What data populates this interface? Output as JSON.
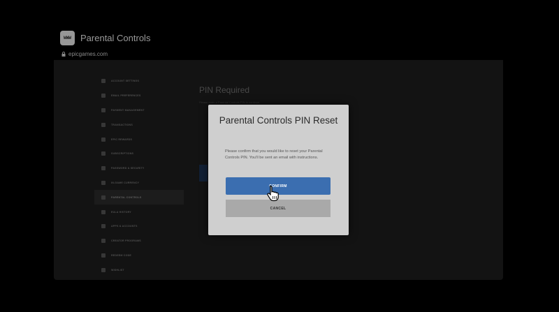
{
  "window": {
    "icon_text": "WWW",
    "title": "Parental Controls",
    "url": "epicgames.com"
  },
  "sidebar": {
    "items": [
      {
        "label": "ACCOUNT SETTINGS",
        "icon": "person-icon"
      },
      {
        "label": "EMAIL PREFERENCES",
        "icon": "bell-icon"
      },
      {
        "label": "PAYMENT MANAGEMENT",
        "icon": "card-icon"
      },
      {
        "label": "TRANSACTIONS",
        "icon": "receipt-icon"
      },
      {
        "label": "EPIC REWARDS",
        "icon": "reward-icon"
      },
      {
        "label": "SUBSCRIPTIONS",
        "icon": "subscription-icon"
      },
      {
        "label": "PASSWORD & SECURITY",
        "icon": "lock-icon"
      },
      {
        "label": "IN-GAME CURRENCY",
        "icon": "currency-icon"
      },
      {
        "label": "PARENTAL CONTROLS",
        "icon": "shield-icon",
        "active": true
      },
      {
        "label": "EULA HISTORY",
        "icon": "document-icon"
      },
      {
        "label": "APPS & ACCOUNTS",
        "icon": "apps-icon"
      },
      {
        "label": "CREATOR PROGRAMS",
        "icon": "creator-icon"
      },
      {
        "label": "REDEEM CODE",
        "icon": "code-icon"
      },
      {
        "label": "WISHLIST",
        "icon": "star-icon"
      }
    ]
  },
  "content": {
    "title": "PIN Required",
    "subtitle": "Please enter a Parental Controls PIN to continue."
  },
  "modal": {
    "title": "Parental Controls PIN Reset",
    "body": "Please confirm that you would like to reset your Parental Controls PIN. You'll be sent an email with instructions.",
    "confirm_label": "CONFIRM",
    "cancel_label": "CANCEL"
  },
  "colors": {
    "confirm": "#3b6eb0",
    "cancel": "#a9a9a9",
    "modal_bg": "#cfcfcf"
  }
}
